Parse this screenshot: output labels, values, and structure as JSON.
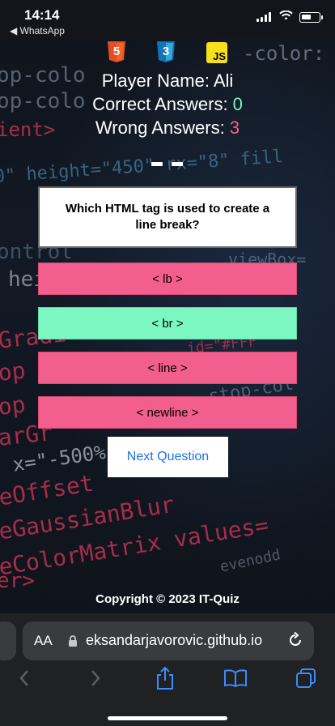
{
  "status_bar": {
    "time": "14:14",
    "back_app": "◀ WhatsApp"
  },
  "logos": [
    "html5-logo",
    "css3-logo",
    "javascript-logo"
  ],
  "logo_text": {
    "js": "JS",
    "html": "5",
    "css": "3"
  },
  "player": {
    "name_label": "Player Name: Ali",
    "correct_label": "Correct Answers: ",
    "correct_value": "0",
    "wrong_label": "Wrong Answers: ",
    "wrong_value": "3"
  },
  "question": {
    "text": "Which HTML tag is used to create a line break?"
  },
  "answers": [
    {
      "label": "< lb >",
      "state": "wrong",
      "color": "#f25e8d"
    },
    {
      "label": "< br >",
      "state": "correct",
      "color": "#7cf7c1"
    },
    {
      "label": "< line >",
      "state": "wrong",
      "color": "#f25e8d"
    },
    {
      "label": "< newline >",
      "state": "wrong",
      "color": "#f25e8d"
    }
  ],
  "next_button": {
    "label": "Next Question"
  },
  "footer": {
    "copyright": "Copyright © 2023 IT-Quiz"
  },
  "browser": {
    "aa_label": "AA",
    "url": "eksandarjavorovic.github.io"
  },
  "colors": {
    "correct_value": "#7cf7c1",
    "wrong_value": "#f25e8d",
    "accent_blue": "#1a73e8",
    "html_orange": "#e44d26",
    "css_blue": "#2965f1",
    "js_yellow": "#f7df1e"
  },
  "background_code": [
    "-color: #",
    "op-colo",
    "op-colo",
    "ient>",
    "0\" height=\"450\" rx=\"8\" fill",
    "ontrol",
    "heigh",
    "Gradi",
    "op",
    "op",
    "arGr",
    "x=\"-500%\"",
    "eOffset",
    "eGaussianBlur",
    "eColorMatrix values=",
    "er>",
    "stop-col",
    "viewBox=",
    "id=\"#FFF",
    "evenodd"
  ]
}
